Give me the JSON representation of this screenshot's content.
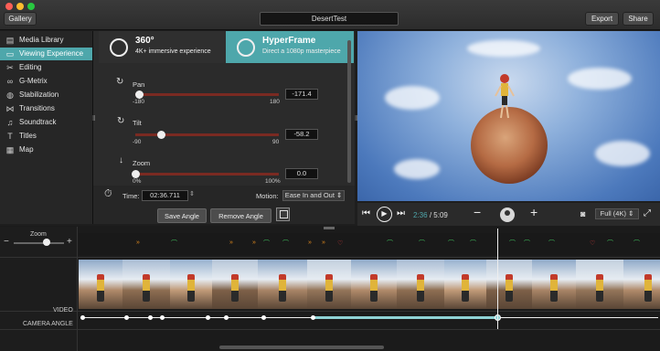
{
  "window": {
    "title": "DesertTest",
    "gallery_label": "Gallery",
    "export_label": "Export",
    "share_label": "Share"
  },
  "sidebar": {
    "items": [
      {
        "label": "Media Library",
        "icon": "film-icon"
      },
      {
        "label": "Viewing Experience",
        "icon": "monitor-icon",
        "active": true
      },
      {
        "label": "Editing",
        "icon": "scissors-icon"
      },
      {
        "label": "G-Metrix",
        "icon": "infinity-icon"
      },
      {
        "label": "Stabilization",
        "icon": "stabilize-icon"
      },
      {
        "label": "Transitions",
        "icon": "bowtie-icon"
      },
      {
        "label": "Soundtrack",
        "icon": "music-note-icon"
      },
      {
        "label": "Titles",
        "icon": "text-t-icon"
      },
      {
        "label": "Map",
        "icon": "map-icon"
      }
    ]
  },
  "modes": {
    "mode360": {
      "title": "360°",
      "subtitle": "4K+ immersive experience"
    },
    "hyperframe": {
      "title": "HyperFrame",
      "subtitle": "Direct a 1080p masterpiece"
    }
  },
  "sliders": {
    "pan": {
      "label": "Pan",
      "min": "-180",
      "max": "180",
      "value": "-171.4",
      "level": 0.024
    },
    "tilt": {
      "label": "Tilt",
      "min": "-90",
      "max": "90",
      "value": "-58.2",
      "level": 0.177
    },
    "zoom": {
      "label": "Zoom",
      "min": "0%",
      "max": "100%",
      "value": "0.0",
      "level": 0.0
    }
  },
  "time": {
    "label": "Time:",
    "value": "02:36.711"
  },
  "motion": {
    "label": "Motion:",
    "value": "Ease In and Out"
  },
  "actions": {
    "save_angle": "Save Angle",
    "remove_angle": "Remove Angle"
  },
  "playback": {
    "current": "2:36",
    "separator": "/",
    "total": "5:09",
    "quality": "Full (4K)"
  },
  "timeline": {
    "zoom_label": "Zoom",
    "minus": "−",
    "plus": "+",
    "video_label": "VIDEO",
    "camera_angle_label": "CAMERA ANGLE"
  },
  "colors": {
    "accent": "#4ea7ab",
    "slider_track": "#7a2a22",
    "marker_orange": "#e08a1e",
    "marker_green": "#3fbf5a",
    "marker_red": "#d23b3b"
  }
}
